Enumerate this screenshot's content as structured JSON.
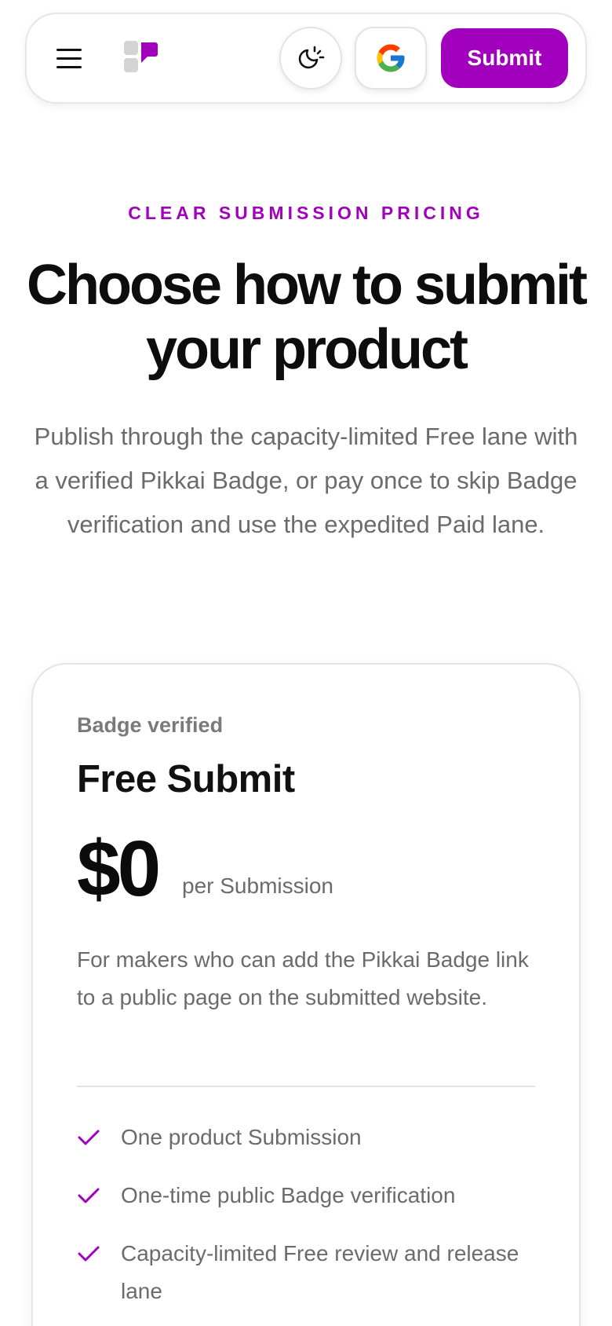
{
  "header": {
    "menu_icon": "hamburger-menu-icon",
    "logo_icon": "pikkai-logo-icon",
    "theme_icon": "theme-toggle-icon",
    "google_icon": "google-icon",
    "submit_label": "Submit"
  },
  "hero": {
    "eyebrow": "CLEAR SUBMISSION PRICING",
    "title": "Choose how to submit your product",
    "subtitle": "Publish through the capacity-limited Free lane with a verified Pikkai Badge, or pay once to skip Badge verification and use the expedited Paid lane."
  },
  "plan": {
    "eyebrow": "Badge verified",
    "name": "Free Submit",
    "price": "$0",
    "unit": "per Submission",
    "description": "For makers who can add the Pikkai Badge link to a public page on the submitted website.",
    "features": [
      "One product Submission",
      "One-time public Badge verification",
      "Capacity-limited Free review and release lane"
    ]
  },
  "colors": {
    "accent": "#a100bd",
    "text": "#111111",
    "muted": "#6b6b6b"
  }
}
